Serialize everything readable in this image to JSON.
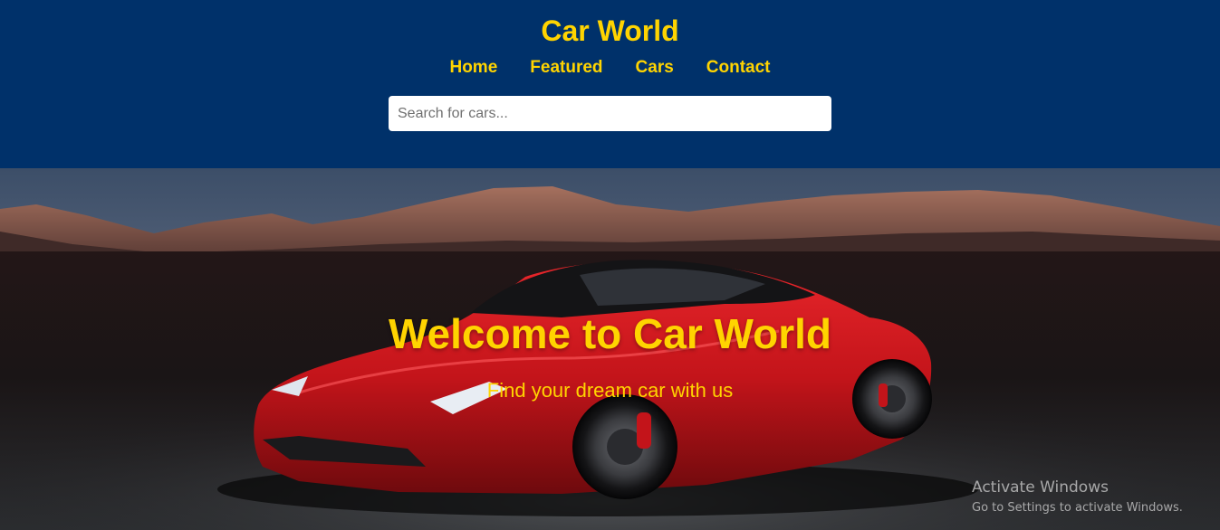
{
  "site": {
    "title": "Car World"
  },
  "nav": {
    "items": [
      {
        "label": "Home"
      },
      {
        "label": "Featured"
      },
      {
        "label": "Cars"
      },
      {
        "label": "Contact"
      }
    ]
  },
  "search": {
    "placeholder": "Search for cars...",
    "value": ""
  },
  "hero": {
    "title": "Welcome to Car World",
    "subtitle": "Find your dream car with us"
  },
  "watermark": {
    "title": "Activate Windows",
    "subtitle": "Go to Settings to activate Windows."
  },
  "colors": {
    "header_bg": "#00316a",
    "accent": "#ffd400",
    "car_red": "#c3141a"
  }
}
